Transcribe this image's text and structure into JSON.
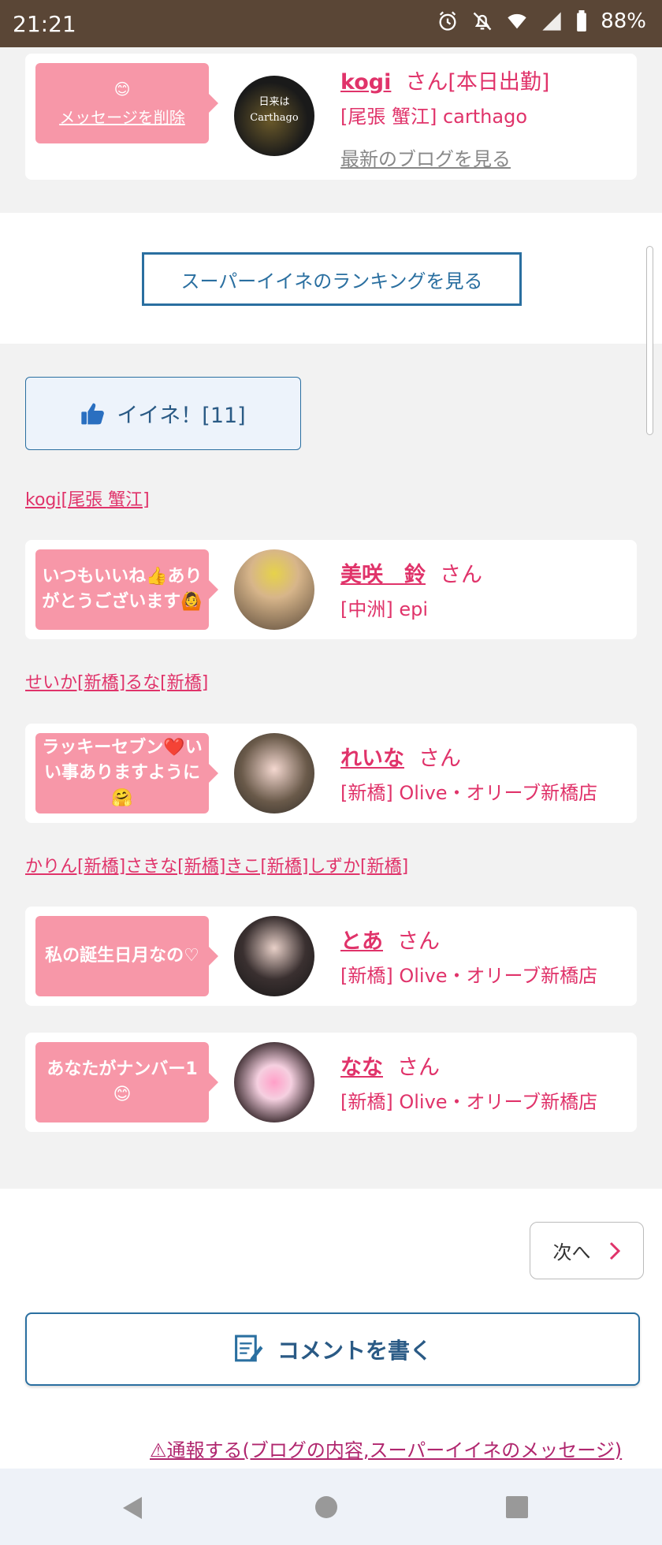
{
  "status_bar": {
    "time": "21:21",
    "battery": "88%"
  },
  "top_card": {
    "bubble_emoji": "😊",
    "delete_link": "メッセージを削除",
    "avatar_text": "日来は Carthago",
    "name": "kogi",
    "suffix": "さん[本日出勤]",
    "shop": "[尾張 蟹江] carthago",
    "blog_link": "最新のブログを見る"
  },
  "ranking_button": "スーパーイイネのランキングを見る",
  "like_button": {
    "label": "イイネ！[11]",
    "icon": "thumbs-up-icon"
  },
  "name_lines": [
    "kogi[尾張 蟹江]",
    "せいか[新橋]るな[新橋]",
    "かりん[新橋]さきな[新橋]きこ[新橋]しずか[新橋]"
  ],
  "messages": [
    {
      "bubble": "いつもいいね👍ありがとうございます🙆",
      "name": "美咲　鈴",
      "suffix": "さん",
      "shop": "[中洲] epi"
    },
    {
      "bubble": "ラッキーセブン❤️いい事ありますように🤗",
      "name": "れいな",
      "suffix": "さん",
      "shop": "[新橋] Olive・オリーブ新橋店"
    },
    {
      "bubble": "私の誕生日月なの♡",
      "name": "とあ",
      "suffix": "さん",
      "shop": "[新橋] Olive・オリーブ新橋店"
    },
    {
      "bubble": "あなたがナンバー1😊",
      "name": "なな",
      "suffix": "さん",
      "shop": "[新橋] Olive・オリーブ新橋店"
    }
  ],
  "next_button": "次へ",
  "comment_button": "コメントを書く",
  "report_link": "⚠通報する(ブログの内容,スーパーイイネのメッセージ)",
  "colors": {
    "accent_pink": "#e0336a",
    "bubble_pink": "#f797a8",
    "blue": "#2a6fa0",
    "status_bar": "#5a4636"
  }
}
